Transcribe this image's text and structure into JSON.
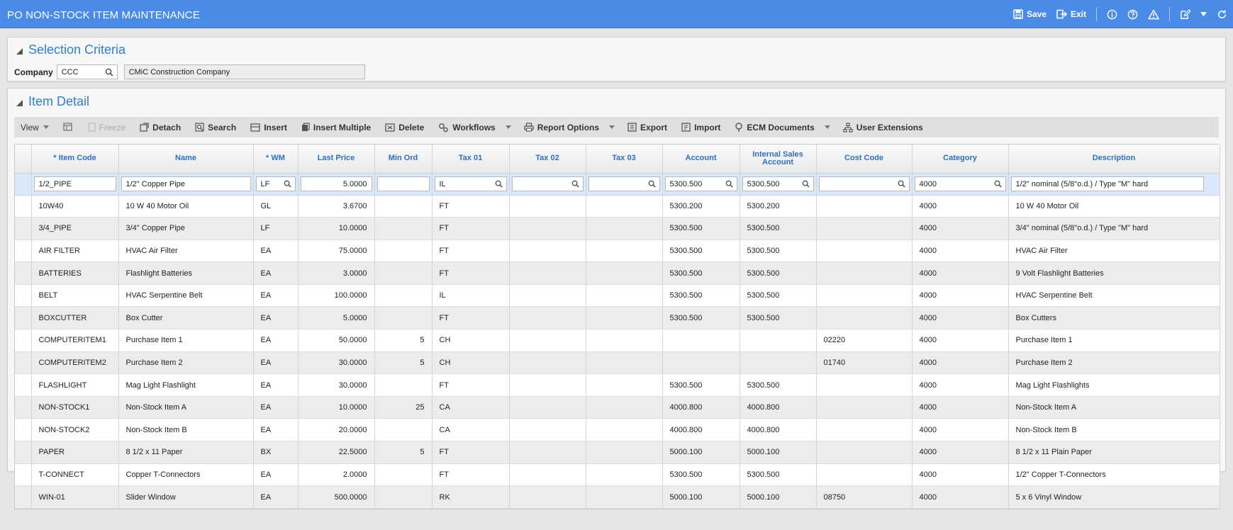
{
  "app": {
    "title": "PO NON-STOCK ITEM MAINTENANCE"
  },
  "titlebar": {
    "save_label": "Save",
    "exit_label": "Exit",
    "icons": [
      "info-icon",
      "help-icon",
      "warning-icon",
      "edit-icon",
      "dropdown-icon",
      "refresh-icon"
    ]
  },
  "selection": {
    "heading": "Selection Criteria",
    "company_label": "Company",
    "company_code": "CCC",
    "company_name": "CMiC Construction Company"
  },
  "detail": {
    "heading": "Item Detail",
    "toolbar": {
      "view": "View",
      "freeze": "Freeze",
      "detach": "Detach",
      "search": "Search",
      "insert": "Insert",
      "insert_multiple": "Insert Multiple",
      "delete": "Delete",
      "workflows": "Workflows",
      "report_options": "Report Options",
      "export": "Export",
      "import": "Import",
      "ecm_documents": "ECM Documents",
      "user_extensions": "User Extensions"
    },
    "columns": [
      "* Item Code",
      "Name",
      "* WM",
      "Last Price",
      "Min Ord",
      "Tax 01",
      "Tax 02",
      "Tax 03",
      "Account",
      "Internal Sales Account",
      "Cost Code",
      "Category",
      "Description"
    ],
    "edit_row": {
      "item_code": "1/2_PIPE",
      "name": "1/2\" Copper Pipe",
      "wm": "LF",
      "last_price": "5.0000",
      "min_ord": "",
      "tax01": "IL",
      "tax02": "",
      "tax03": "",
      "account": "5300.500",
      "internal_sales_account": "5300.500",
      "cost_code": "",
      "category": "4000",
      "description": "1/2\" nominal (5/8\"o.d.) / Type \"M\" hard"
    },
    "rows": [
      {
        "item_code": "10W40",
        "name": "10 W 40 Motor Oil",
        "wm": "GL",
        "last_price": "3.6700",
        "min_ord": "",
        "tax01": "FT",
        "tax02": "",
        "tax03": "",
        "account": "5300.200",
        "isa": "5300.200",
        "cost_code": "",
        "category": "4000",
        "description": "10 W 40 Motor Oil"
      },
      {
        "item_code": "3/4_PIPE",
        "name": "3/4\" Copper Pipe",
        "wm": "LF",
        "last_price": "10.0000",
        "min_ord": "",
        "tax01": "FT",
        "tax02": "",
        "tax03": "",
        "account": "5300.500",
        "isa": "5300.500",
        "cost_code": "",
        "category": "4000",
        "description": "3/4\" nominal (5/8\"o.d.) / Type \"M\" hard"
      },
      {
        "item_code": "AIR FILTER",
        "name": "HVAC Air Filter",
        "wm": "EA",
        "last_price": "75.0000",
        "min_ord": "",
        "tax01": "FT",
        "tax02": "",
        "tax03": "",
        "account": "5300.500",
        "isa": "5300.500",
        "cost_code": "",
        "category": "4000",
        "description": "HVAC Air Filter"
      },
      {
        "item_code": "BATTERIES",
        "name": "Flashlight Batteries",
        "wm": "EA",
        "last_price": "3.0000",
        "min_ord": "",
        "tax01": "FT",
        "tax02": "",
        "tax03": "",
        "account": "5300.500",
        "isa": "5300.500",
        "cost_code": "",
        "category": "4000",
        "description": "9 Volt Flashlight Batteries"
      },
      {
        "item_code": "BELT",
        "name": "HVAC Serpentine Belt",
        "wm": "EA",
        "last_price": "100.0000",
        "min_ord": "",
        "tax01": "IL",
        "tax02": "",
        "tax03": "",
        "account": "5300.500",
        "isa": "5300.500",
        "cost_code": "",
        "category": "4000",
        "description": "HVAC Serpentine Belt"
      },
      {
        "item_code": "BOXCUTTER",
        "name": "Box Cutter",
        "wm": "EA",
        "last_price": "5.0000",
        "min_ord": "",
        "tax01": "FT",
        "tax02": "",
        "tax03": "",
        "account": "5300.500",
        "isa": "5300.500",
        "cost_code": "",
        "category": "4000",
        "description": "Box Cutters"
      },
      {
        "item_code": "COMPUTERITEM1",
        "name": "Purchase Item 1",
        "wm": "EA",
        "last_price": "50.0000",
        "min_ord": "5",
        "tax01": "CH",
        "tax02": "",
        "tax03": "",
        "account": "",
        "isa": "",
        "cost_code": "02220",
        "category": "4000",
        "description": "Purchase Item 1"
      },
      {
        "item_code": "COMPUTERITEM2",
        "name": "Purchase Item 2",
        "wm": "EA",
        "last_price": "30.0000",
        "min_ord": "5",
        "tax01": "CH",
        "tax02": "",
        "tax03": "",
        "account": "",
        "isa": "",
        "cost_code": "01740",
        "category": "4000",
        "description": "Purchase Item 2"
      },
      {
        "item_code": "FLASHLIGHT",
        "name": "Mag Light Flashlight",
        "wm": "EA",
        "last_price": "30.0000",
        "min_ord": "",
        "tax01": "FT",
        "tax02": "",
        "tax03": "",
        "account": "5300.500",
        "isa": "5300.500",
        "cost_code": "",
        "category": "4000",
        "description": "Mag Light Flashlights"
      },
      {
        "item_code": "NON-STOCK1",
        "name": "Non-Stock Item A",
        "wm": "EA",
        "last_price": "10.0000",
        "min_ord": "25",
        "tax01": "CA",
        "tax02": "",
        "tax03": "",
        "account": "4000.800",
        "isa": "4000.800",
        "cost_code": "",
        "category": "4000",
        "description": "Non-Stock Item A"
      },
      {
        "item_code": "NON-STOCK2",
        "name": "Non-Stock Item B",
        "wm": "EA",
        "last_price": "20.0000",
        "min_ord": "",
        "tax01": "CA",
        "tax02": "",
        "tax03": "",
        "account": "4000.800",
        "isa": "4000.800",
        "cost_code": "",
        "category": "4000",
        "description": "Non-Stock Item B"
      },
      {
        "item_code": "PAPER",
        "name": "8 1/2 x 11 Paper",
        "wm": "BX",
        "last_price": "22.5000",
        "min_ord": "5",
        "tax01": "FT",
        "tax02": "",
        "tax03": "",
        "account": "5000.100",
        "isa": "5000.100",
        "cost_code": "",
        "category": "4000",
        "description": "8 1/2 x 11 Plain Paper"
      },
      {
        "item_code": "T-CONNECT",
        "name": "Copper T-Connectors",
        "wm": "EA",
        "last_price": "2.0000",
        "min_ord": "",
        "tax01": "FT",
        "tax02": "",
        "tax03": "",
        "account": "5300.500",
        "isa": "5300.500",
        "cost_code": "",
        "category": "4000",
        "description": "1/2\" Copper T-Connectors"
      },
      {
        "item_code": "WIN-01",
        "name": "Slider Window",
        "wm": "EA",
        "last_price": "500.0000",
        "min_ord": "",
        "tax01": "RK",
        "tax02": "",
        "tax03": "",
        "account": "5000.100",
        "isa": "5000.100",
        "cost_code": "08750",
        "category": "4000",
        "description": "5 x 6 Vinyl Window"
      }
    ]
  },
  "colors": {
    "titlebar": "#4a8be8",
    "heading": "#2f7fd0",
    "header_text": "#2c6fc3",
    "edit_row": "#d9e7fb"
  }
}
